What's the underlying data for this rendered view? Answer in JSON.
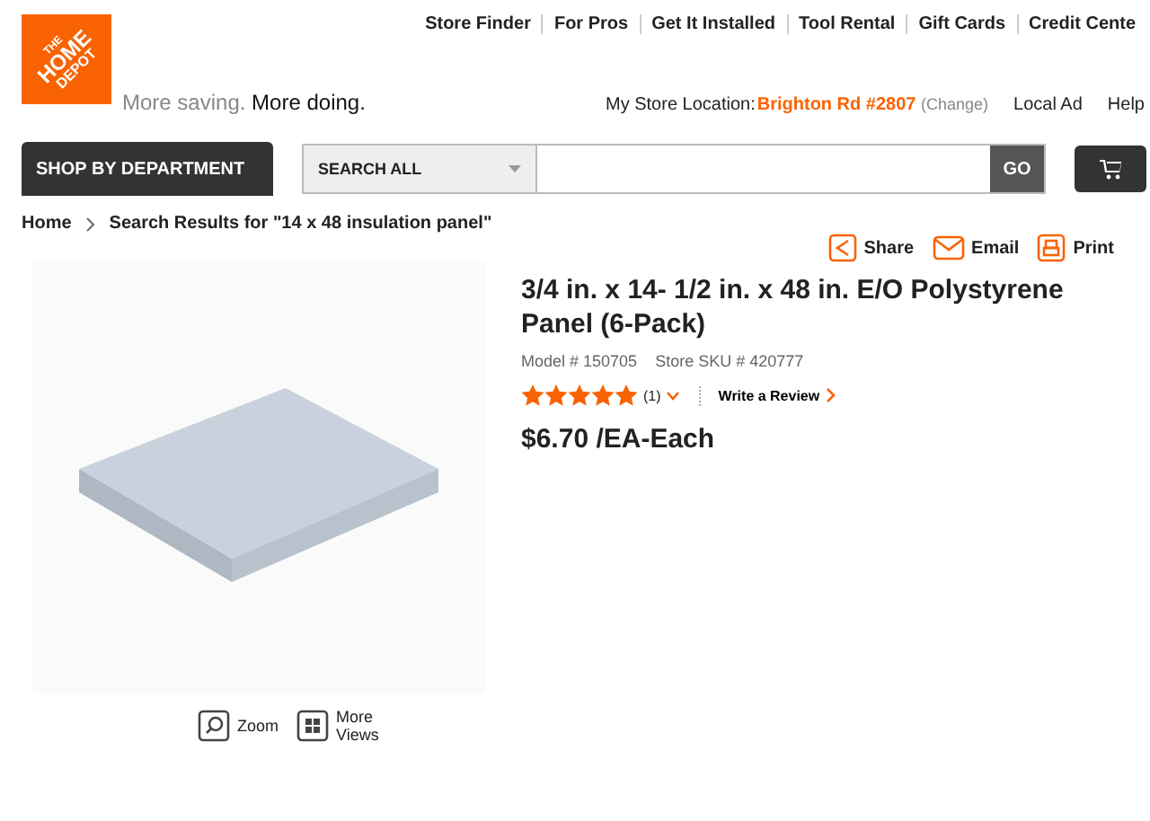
{
  "logo": {
    "lines": [
      "THE",
      "HOME",
      "DEPOT"
    ]
  },
  "tagline": {
    "light": "More saving.",
    "bold": "More doing."
  },
  "top_links": [
    "Store Finder",
    "For Pros",
    "Get It Installed",
    "Tool Rental",
    "Gift Cards",
    "Credit Cente"
  ],
  "store": {
    "label": "My Store Location:",
    "name": "Brighton Rd #2807",
    "change": "(Change)"
  },
  "secondary_links": [
    "Local Ad",
    "Help"
  ],
  "shop_button": "SHOP BY DEPARTMENT",
  "search": {
    "scope": "SEARCH ALL",
    "go": "GO"
  },
  "breadcrumb": [
    "Home",
    "Search Results for \"14 x 48 insulation panel\""
  ],
  "actions": [
    {
      "kind": "share",
      "label": "Share"
    },
    {
      "kind": "email",
      "label": "Email"
    },
    {
      "kind": "print",
      "label": "Print"
    }
  ],
  "product": {
    "title": "3/4 in. x 14- 1/2 in. x 48 in. E/O Polystyrene Panel (6-Pack)",
    "model": "Model # 150705",
    "sku": "Store SKU # 420777",
    "stars": 5,
    "review_count": "(1)",
    "write_review": "Write a Review",
    "price": "$6.70 /EA-Each"
  },
  "image_tools": [
    {
      "kind": "zoom",
      "label": "Zoom"
    },
    {
      "kind": "views",
      "label": "More Views"
    }
  ]
}
